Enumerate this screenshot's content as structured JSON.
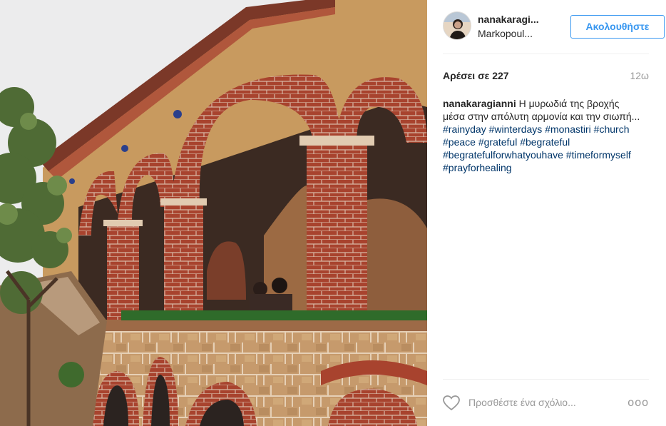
{
  "post": {
    "image_alt": "Monastery brick arches",
    "user": {
      "username": "nanakaragi...",
      "location": "Markopoul..."
    },
    "follow_label": "Ακολουθήστε",
    "likes_text": "Αρέσει σε 227",
    "time_text": "12ω",
    "caption": {
      "user": "nanakaragianni",
      "line1": " Η μυρωδιά της βροχής",
      "line2": "μέσα στην απόλυτη αρμονία και την σιωπή...",
      "hashtags_line1": [
        "#rainyday",
        "#winterdays",
        "#monastiri",
        "#church"
      ],
      "hashtags_line2": [
        "#peace",
        "#grateful",
        "#begrateful"
      ],
      "hashtags_line3": [
        "#begratefulforwhatyouhave",
        "#timeformyself"
      ],
      "hashtags_line4": [
        "#prayforhealing"
      ]
    },
    "comment_placeholder": "Προσθέστε ένα σχόλιο...",
    "more_label": "ooo",
    "icons": {
      "like": "heart-icon",
      "more": "more-options-icon"
    },
    "colors": {
      "link": "#003569",
      "follow": "#3897f0"
    }
  }
}
